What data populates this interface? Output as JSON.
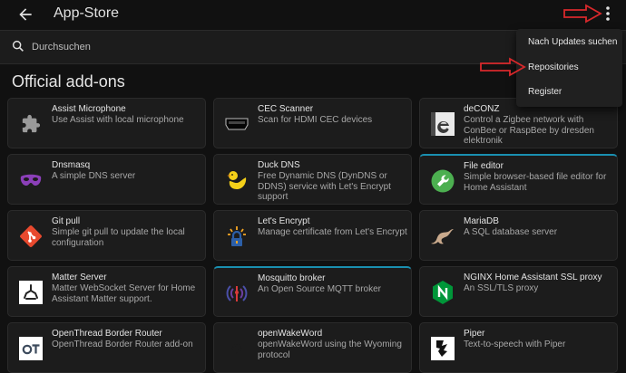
{
  "header": {
    "title": "App-Store"
  },
  "search": {
    "placeholder": "Durchsuchen"
  },
  "section": {
    "title": "Official add-ons"
  },
  "menu": {
    "items": [
      "Nach Updates suchen",
      "Repositories",
      "Register"
    ]
  },
  "addons": [
    {
      "name": "Assist Microphone",
      "description": "Use Assist with local microphone",
      "icon": "puzzle-icon"
    },
    {
      "name": "CEC Scanner",
      "description": "Scan for HDMI CEC devices",
      "icon": "hdmi-icon"
    },
    {
      "name": "deCONZ",
      "description": "Control a Zigbee network with ConBee or RaspBee by dresden elektronik",
      "icon": "deconz-icon"
    },
    {
      "name": "Dnsmasq",
      "description": "A simple DNS server",
      "icon": "mask-icon"
    },
    {
      "name": "Duck DNS",
      "description": "Free Dynamic DNS (DynDNS or DDNS) service with Let's Encrypt support",
      "icon": "duck-icon"
    },
    {
      "name": "File editor",
      "description": "Simple browser-based file editor for Home Assistant",
      "icon": "wrench-icon"
    },
    {
      "name": "Git pull",
      "description": "Simple git pull to update the local configuration",
      "icon": "git-icon"
    },
    {
      "name": "Let's Encrypt",
      "description": "Manage certificate from Let's Encrypt",
      "icon": "lock-icon"
    },
    {
      "name": "MariaDB",
      "description": "A SQL database server",
      "icon": "seal-icon"
    },
    {
      "name": "Matter Server",
      "description": "Matter WebSocket Server for Home Assistant Matter support.",
      "icon": "matter-icon"
    },
    {
      "name": "Mosquitto broker",
      "description": "An Open Source MQTT broker",
      "icon": "mqtt-icon"
    },
    {
      "name": "NGINX Home Assistant SSL proxy",
      "description": "An SSL/TLS proxy",
      "icon": "nginx-icon"
    },
    {
      "name": "OpenThread Border Router",
      "description": "OpenThread Border Router add-on",
      "icon": "openthread-icon"
    },
    {
      "name": "openWakeWord",
      "description": "openWakeWord using the Wyoming protocol",
      "icon": "wake-icon"
    },
    {
      "name": "Piper",
      "description": "Text-to-speech with Piper",
      "icon": "piper-icon"
    }
  ],
  "colors": {
    "accent": "#1a8fb0",
    "annotation": "#d8282b",
    "background": "#111111",
    "card": "#1c1c1c"
  }
}
